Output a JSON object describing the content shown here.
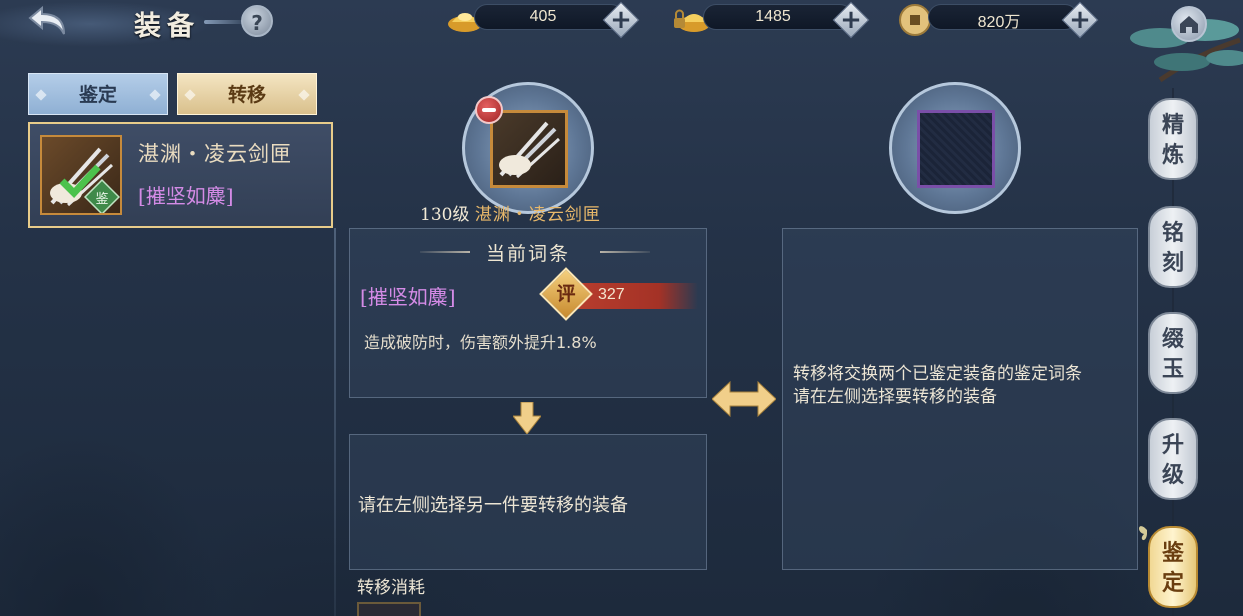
{
  "header": {
    "title": "装备"
  },
  "currencies": [
    {
      "icon": "gold-ingot-icon",
      "value": "405"
    },
    {
      "icon": "bound-gold-ingot-icon",
      "value": "1485"
    },
    {
      "icon": "copper-coin-icon",
      "value": "820万"
    }
  ],
  "tabs": {
    "appraise": "鉴定",
    "transfer": "转移"
  },
  "item_card": {
    "name": "湛渊・凌云剑匣",
    "tag": "[摧坚如麋]",
    "badge": "鉴"
  },
  "slot_left": {
    "level": "130级",
    "name": "湛渊・凌云剑匣"
  },
  "current_panel": {
    "header": "当前词条",
    "attr_name": "[摧坚如麋]",
    "score_label": "评",
    "score_value": "327",
    "description": "造成破防时，伤害额外提升1.8%"
  },
  "target_panel": {
    "text": "请在左侧选择另一件要转移的装备"
  },
  "info_panel": {
    "line1": "转移将交换两个已鉴定装备的鉴定词条",
    "line2": "请在左侧选择要转移的装备"
  },
  "cost": {
    "title": "转移消耗"
  },
  "side_tabs": [
    {
      "label": "精炼"
    },
    {
      "label": "铭刻"
    },
    {
      "label": "缀玉"
    },
    {
      "label": "升级"
    },
    {
      "label": "鉴定",
      "active": true
    }
  ],
  "colors": {
    "accent_gold": "#e8cc8a",
    "attr_purple": "#d48be6",
    "item_name_orange": "#e8b86a",
    "score_red": "#b93e2e"
  }
}
